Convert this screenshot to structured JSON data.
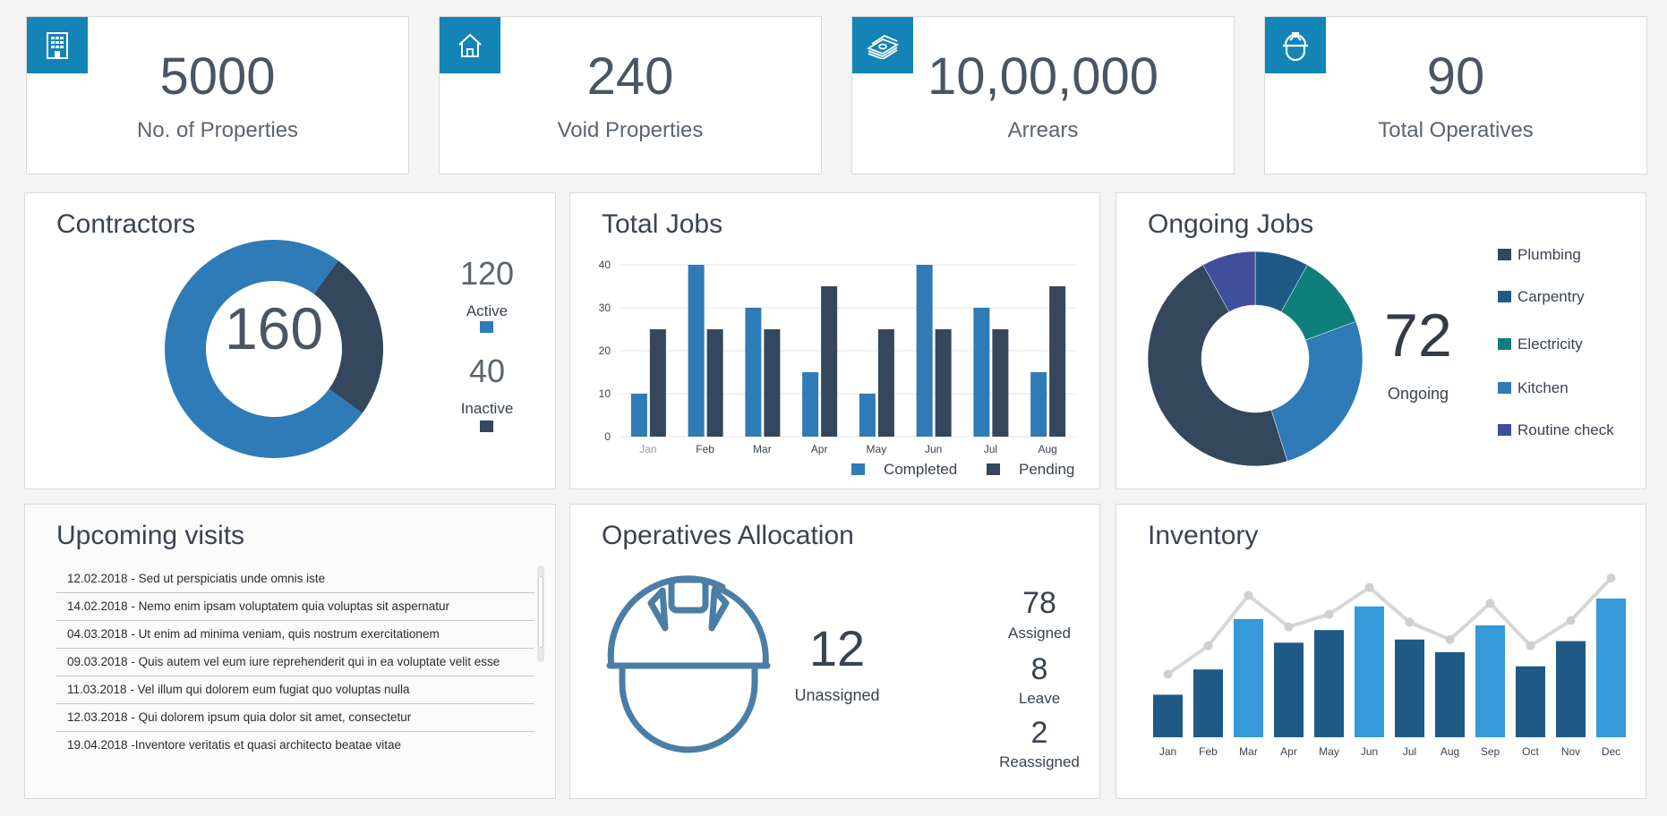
{
  "kpis": [
    {
      "value": "5000",
      "label": "No. of Properties",
      "icon": "building-icon"
    },
    {
      "value": "240",
      "label": "Void Properties",
      "icon": "house-icon"
    },
    {
      "value": "10,00,000",
      "label": "Arrears",
      "icon": "money-stack-icon"
    },
    {
      "value": "90",
      "label": "Total Operatives",
      "icon": "hard-hat-icon"
    }
  ],
  "contractors": {
    "title": "Contractors",
    "total": "160",
    "active_value": "120",
    "active_label": "Active",
    "inactive_value": "40",
    "inactive_label": "Inactive"
  },
  "total_jobs": {
    "title": "Total Jobs",
    "legend_completed": "Completed",
    "legend_pending": "Pending"
  },
  "ongoing_jobs": {
    "title": "Ongoing Jobs",
    "total": "72",
    "total_label": "Ongoing",
    "legend": [
      "Plumbing",
      "Carpentry",
      "Electricity",
      "Kitchen",
      "Routine check"
    ]
  },
  "upcoming_visits": {
    "title": "Upcoming visits",
    "items": [
      "12.02.2018 - Sed ut perspiciatis unde omnis iste",
      "14.02.2018 - Nemo enim ipsam voluptatem quia voluptas sit aspernatur",
      "04.03.2018 - Ut enim ad minima veniam, quis nostrum exercitationem",
      "09.03.2018 - Quis autem vel eum iure reprehenderit qui in ea voluptate velit esse",
      "11.03.2018 -  Vel illum qui dolorem eum fugiat quo voluptas nulla",
      "12.03.2018 - Qui dolorem ipsum quia dolor sit amet, consectetur",
      "19.04.2018 -Inventore veritatis et quasi architecto beatae vitae"
    ]
  },
  "operatives": {
    "title": "Operatives Allocation",
    "unassigned_value": "12",
    "unassigned_label": "Unassigned",
    "assigned_value": "78",
    "assigned_label": "Assigned",
    "leave_value": "8",
    "leave_label": "Leave",
    "reassigned_value": "2",
    "reassigned_label": "Reassigned"
  },
  "inventory": {
    "title": "Inventory"
  },
  "colors": {
    "accent": "#1384b5",
    "blue": "#2e7bb8",
    "navy": "#34475c",
    "teal": "#0f7f7c",
    "indigo": "#3f4f9c",
    "dark_blue": "#1f5a86",
    "light_blue": "#3699d8",
    "gray_line": "#d3d3d3"
  },
  "chart_data": [
    {
      "type": "pie",
      "title": "Contractors",
      "labels": [
        "Active",
        "Inactive"
      ],
      "values": [
        120,
        40
      ],
      "colors": [
        "#2e7bb8",
        "#34475c"
      ]
    },
    {
      "type": "bar",
      "title": "Total Jobs",
      "categories": [
        "Jan",
        "Feb",
        "Mar",
        "Apr",
        "May",
        "Jun",
        "Jul",
        "Aug"
      ],
      "series": [
        {
          "name": "Completed",
          "values": [
            10,
            40,
            30,
            15,
            10,
            40,
            30,
            15
          ],
          "color": "#2e7bb8"
        },
        {
          "name": "Pending",
          "values": [
            25,
            25,
            25,
            35,
            25,
            25,
            25,
            35
          ],
          "color": "#34475c"
        }
      ],
      "yticks": [
        0,
        10,
        20,
        30,
        40
      ],
      "ylim": [
        0,
        40
      ],
      "grid": true,
      "legend": "bottom-right"
    },
    {
      "type": "pie",
      "title": "Ongoing Jobs",
      "labels": [
        "Plumbing",
        "Carpentry",
        "Electricity",
        "Kitchen",
        "Routine check"
      ],
      "values": [
        5,
        5,
        7,
        16,
        29,
        5
      ],
      "slices": [
        {
          "label": "Carpentry",
          "value": 5,
          "color": "#1f5a86"
        },
        {
          "label": "Electricity",
          "value": 7,
          "color": "#0f7f7c"
        },
        {
          "label": "Kitchen",
          "value": 16,
          "color": "#2e7bb8"
        },
        {
          "label": "Plumbing",
          "value": 29,
          "color": "#34475c"
        },
        {
          "label": "Routine check",
          "value": 5,
          "color": "#3f4f9c"
        }
      ],
      "legend_colors": [
        "#34475c",
        "#1f5a86",
        "#0f7f7c",
        "#2e7bb8",
        "#3f4f9c"
      ]
    },
    {
      "type": "bar",
      "title": "Inventory",
      "categories": [
        "Jan",
        "Feb",
        "Mar",
        "Apr",
        "May",
        "Jun",
        "Jul",
        "Aug",
        "Sep",
        "Oct",
        "Nov",
        "Dec"
      ],
      "values": [
        27,
        43,
        75,
        60,
        68,
        83,
        62,
        54,
        71,
        45,
        61,
        88
      ],
      "bar_colors": [
        "#1f5a86",
        "#1f5a86",
        "#3699d8",
        "#1f5a86",
        "#1f5a86",
        "#3699d8",
        "#1f5a86",
        "#1f5a86",
        "#3699d8",
        "#1f5a86",
        "#1f5a86",
        "#3699d8"
      ],
      "line_values": [
        40,
        58,
        90,
        70,
        78,
        95,
        73,
        62,
        85,
        58,
        74,
        101
      ],
      "ylim": [
        0,
        105
      ]
    }
  ]
}
